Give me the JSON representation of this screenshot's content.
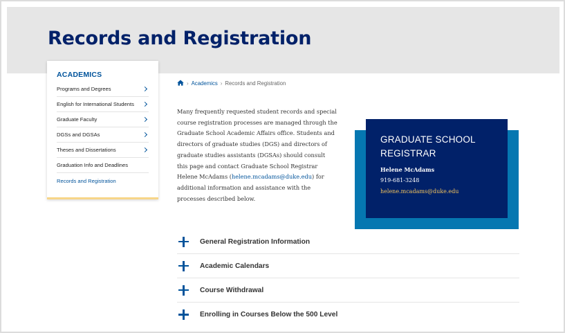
{
  "page": {
    "title": "Records and Registration"
  },
  "sidebar": {
    "heading": "ACADEMICS",
    "items": [
      {
        "label": "Programs and Degrees",
        "has_children": true
      },
      {
        "label": "English for International Students",
        "has_children": true
      },
      {
        "label": "Graduate Faculty",
        "has_children": true
      },
      {
        "label": "DGSs and DGSAs",
        "has_children": true
      },
      {
        "label": "Theses and Dissertations",
        "has_children": true
      },
      {
        "label": "Graduation Info and Deadlines",
        "has_children": false
      },
      {
        "label": "Records and Registration",
        "has_children": false,
        "active": true
      }
    ]
  },
  "breadcrumb": {
    "home_icon": "home-icon",
    "items": [
      "Academics",
      "Records and Registration"
    ]
  },
  "intro": {
    "text_before": "Many frequently requested student records and special course registration processes are managed through the Graduate School Academic Affairs office. Students and directors of graduate studies (DGS) and directors of graduate studies assistants (DGSAs) should consult this page and contact Graduate School Registrar Helene McAdams (",
    "email_link": "helene.mcadams@duke.edu",
    "text_after": ") for additional information and assistance with the processes described below."
  },
  "registrar_card": {
    "title": "GRADUATE SCHOOL REGISTRAR",
    "name": "Helene McAdams",
    "phone": "919-681-3248",
    "email": "helene.mcadams@duke.edu"
  },
  "accordion": {
    "items": [
      "General Registration Information",
      "Academic Calendars",
      "Course Withdrawal",
      "Enrolling in Courses Below the 500 Level"
    ]
  },
  "colors": {
    "brand_navy": "#012169",
    "link_blue": "#00539b",
    "card_accent": "#0577b1",
    "email_gold": "#f4c45c",
    "sidebar_underline": "#f7d588",
    "hero_gray": "#e6e6e6"
  }
}
